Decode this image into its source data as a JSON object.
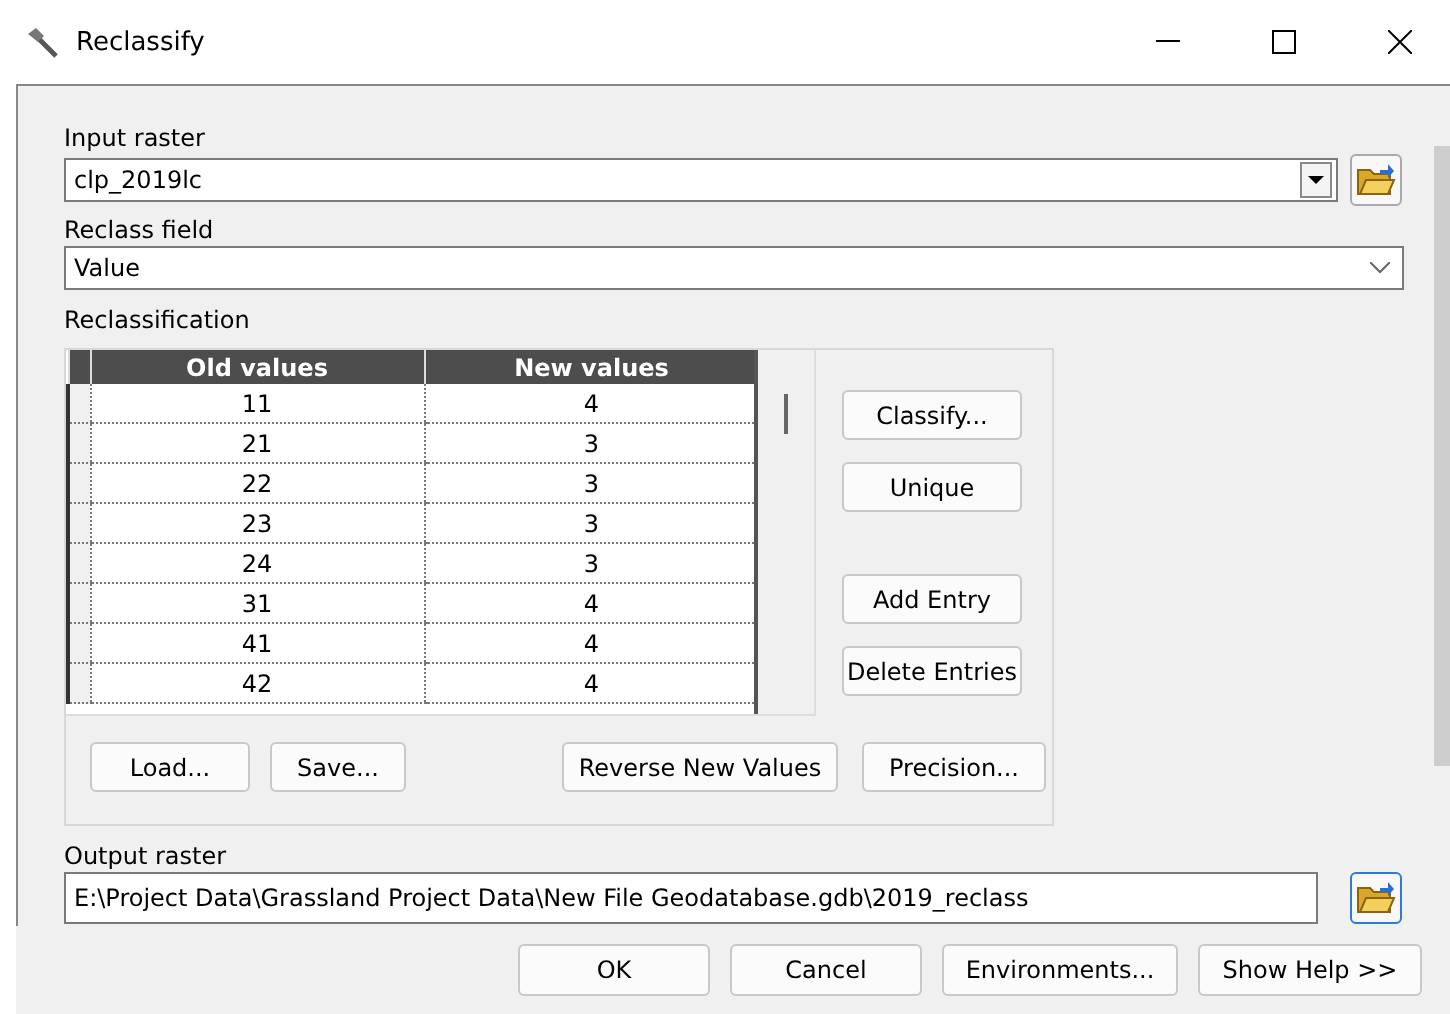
{
  "window": {
    "title": "Reclassify"
  },
  "input_raster": {
    "label": "Input raster",
    "value": "clp_2019lc"
  },
  "reclass_field": {
    "label": "Reclass field",
    "value": "Value"
  },
  "reclassification": {
    "label": "Reclassification",
    "columns": [
      "Old values",
      "New values"
    ],
    "rows": [
      {
        "old": "11",
        "new": "4"
      },
      {
        "old": "21",
        "new": "3"
      },
      {
        "old": "22",
        "new": "3"
      },
      {
        "old": "23",
        "new": "3"
      },
      {
        "old": "24",
        "new": "3"
      },
      {
        "old": "31",
        "new": "4"
      },
      {
        "old": "41",
        "new": "4"
      },
      {
        "old": "42",
        "new": "4"
      }
    ],
    "side_button_groups": [
      [
        "Classify...",
        "Unique"
      ],
      [
        "Add Entry",
        "Delete Entries"
      ]
    ],
    "bottom_buttons": [
      "Load...",
      "Save...",
      "Reverse New Values",
      "Precision..."
    ]
  },
  "output_raster": {
    "label": "Output raster",
    "value": "E:\\Project Data\\Grassland Project Data\\New File Geodatabase.gdb\\2019_reclass"
  },
  "buttons": [
    "OK",
    "Cancel",
    "Environments...",
    "Show Help >>"
  ]
}
